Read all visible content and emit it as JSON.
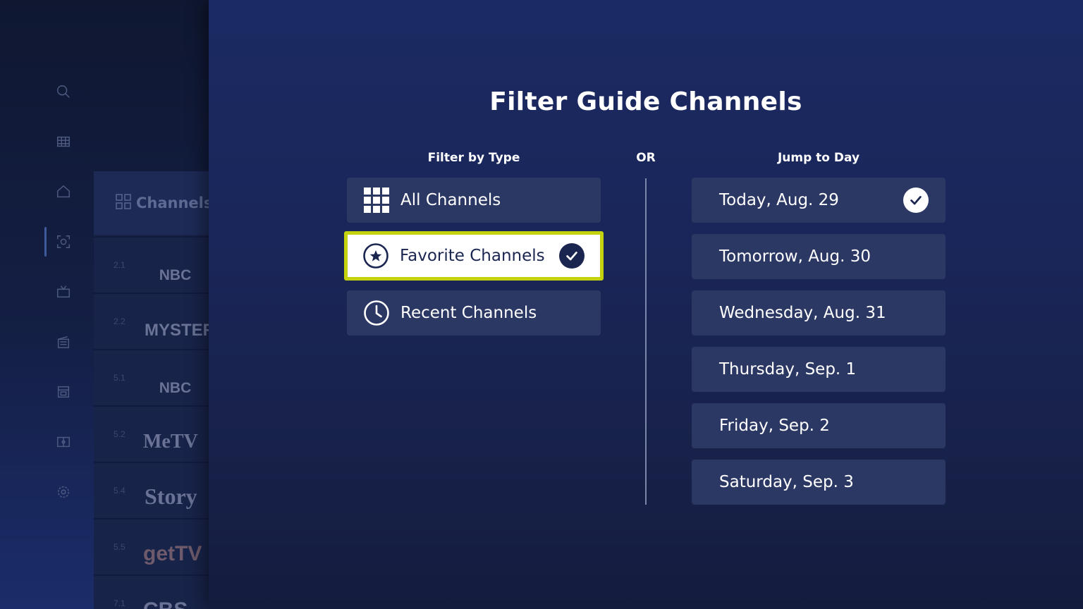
{
  "sidebar": {
    "icons": [
      {
        "name": "search-icon"
      },
      {
        "name": "guide-grid-icon"
      },
      {
        "name": "home-icon"
      },
      {
        "name": "live-focus-icon",
        "active": true
      },
      {
        "name": "tv-icon"
      },
      {
        "name": "movies-icon"
      },
      {
        "name": "recordings-icon"
      },
      {
        "name": "sports-icon"
      },
      {
        "name": "settings-icon"
      }
    ]
  },
  "guide": {
    "header_label": "Channels",
    "channels": [
      {
        "number": "2.1",
        "logo": "NBC"
      },
      {
        "number": "2.2",
        "logo": "MYSTERY"
      },
      {
        "number": "5.1",
        "logo": "NBC"
      },
      {
        "number": "5.2",
        "logo": "MeTV"
      },
      {
        "number": "5.4",
        "logo": "Story"
      },
      {
        "number": "5.5",
        "logo": "getTV"
      },
      {
        "number": "7.1",
        "logo": "CBS"
      }
    ]
  },
  "panel": {
    "title": "Filter Guide Channels",
    "filter_type_label": "Filter by Type",
    "or_label": "OR",
    "jump_day_label": "Jump to Day",
    "filter_options": [
      {
        "label": "All Channels",
        "icon": "grid-icon",
        "selected": false
      },
      {
        "label": "Favorite Channels",
        "icon": "star-circle-icon",
        "selected": true,
        "focused": true
      },
      {
        "label": "Recent Channels",
        "icon": "clock-icon",
        "selected": false
      }
    ],
    "days": [
      {
        "label": "Today, Aug. 29",
        "selected": true
      },
      {
        "label": "Tomorrow, Aug. 30",
        "selected": false
      },
      {
        "label": "Wednesday, Aug. 31",
        "selected": false
      },
      {
        "label": "Thursday, Sep. 1",
        "selected": false
      },
      {
        "label": "Friday, Sep. 2",
        "selected": false
      },
      {
        "label": "Saturday, Sep. 3",
        "selected": false
      }
    ]
  },
  "colors": {
    "focus_border": "#c3d20c",
    "panel_bg": "#1b2a63",
    "button_bg": "#2c3864",
    "dark_navy": "#1a2550"
  }
}
